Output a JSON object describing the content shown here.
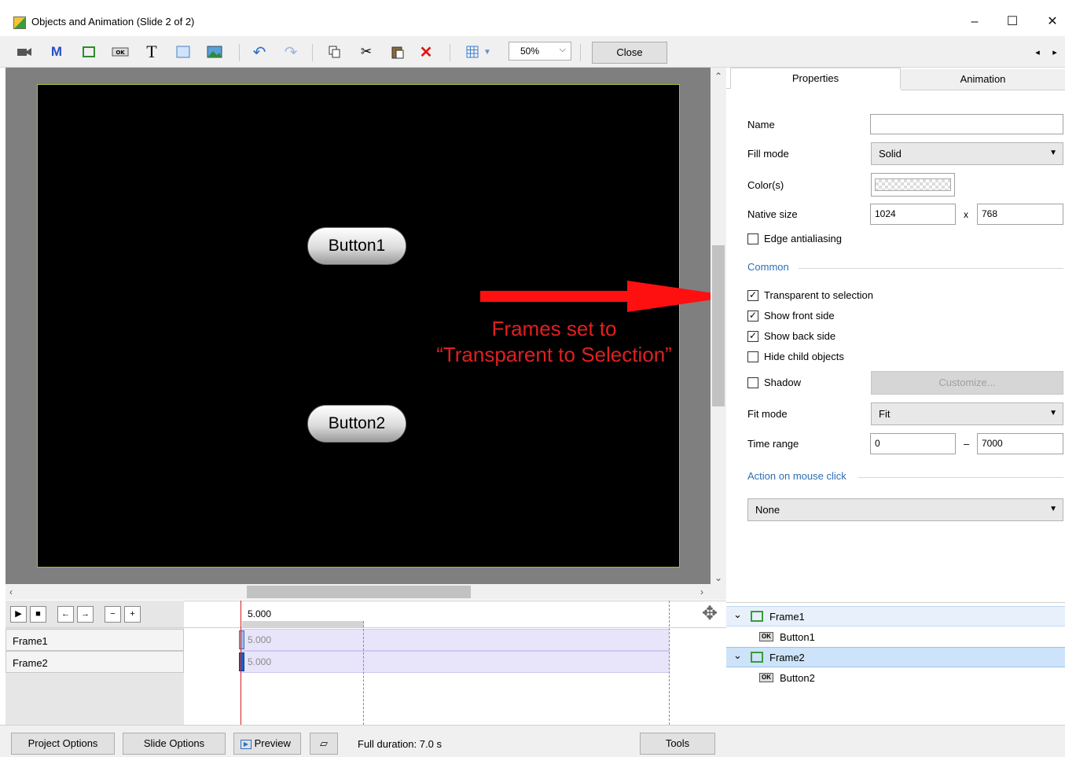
{
  "window": {
    "title": "Objects and Animation (Slide 2 of 2)",
    "minimize": "–",
    "maximize": "☐",
    "close": "✕"
  },
  "toolbar": {
    "zoom_value": "50%",
    "close_label": "Close",
    "nav_prev": "◂",
    "nav_next": "▸"
  },
  "slide": {
    "button1_label": "Button1",
    "button2_label": "Button2",
    "annotation_line1": "Frames set to",
    "annotation_line2": "“Transparent to Selection”",
    "annotation_color": "#e02020"
  },
  "timeline": {
    "ruler_time": "5.000",
    "tracks": [
      {
        "name": "Frame1",
        "value": "5.000"
      },
      {
        "name": "Frame2",
        "value": "5.000"
      }
    ]
  },
  "bottom": {
    "project_options": "Project Options",
    "slide_options": "Slide Options",
    "preview": "Preview",
    "full_duration": "Full duration: 7.0 s",
    "tools": "Tools"
  },
  "tabs": {
    "properties": "Properties",
    "animation": "Animation"
  },
  "properties": {
    "name_label": "Name",
    "name_value": "",
    "fill_mode_label": "Fill mode",
    "fill_mode_value": "Solid",
    "colors_label": "Color(s)",
    "native_size_label": "Native size",
    "native_width": "1024",
    "native_x": "x",
    "native_height": "768",
    "edge_antialiasing_label": "Edge antialiasing",
    "edge_antialiasing_checked": false,
    "common_label": "Common",
    "transparent_label": "Transparent to selection",
    "transparent_checked": true,
    "show_front_label": "Show front side",
    "show_front_checked": true,
    "show_back_label": "Show back side",
    "show_back_checked": true,
    "hide_child_label": "Hide child objects",
    "hide_child_checked": false,
    "shadow_label": "Shadow",
    "shadow_checked": false,
    "customize_label": "Customize...",
    "fit_mode_label": "Fit mode",
    "fit_mode_value": "Fit",
    "time_range_label": "Time range",
    "time_range_start": "0",
    "time_range_dash": "–",
    "time_range_end": "7000",
    "action_label": "Action on mouse click",
    "action_value": "None",
    "check_mark": "✓"
  },
  "tree": {
    "items": [
      {
        "label": "Frame1",
        "type": "frame",
        "expanded": true
      },
      {
        "label": "Button1",
        "type": "button"
      },
      {
        "label": "Frame2",
        "type": "frame",
        "expanded": true
      },
      {
        "label": "Button2",
        "type": "button"
      }
    ],
    "ok_text": "OK",
    "expand_glyph": "⌄"
  }
}
